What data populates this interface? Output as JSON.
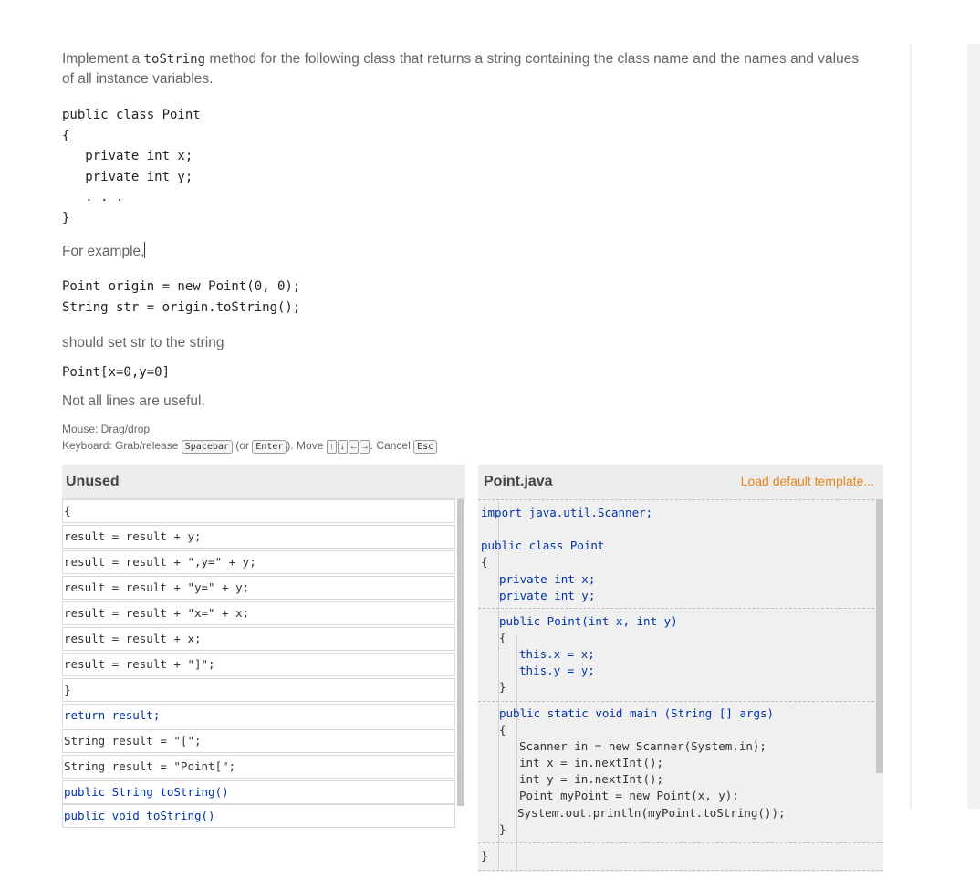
{
  "prompt": {
    "intro_before": "Implement a",
    "intro_code": "toString",
    "intro_after": "method for the following class that returns a string containing the class name and the names and values",
    "intro_line2": "of all instance variables.",
    "class_code": "public class Point\n{\n   private int x;\n   private int y;\n   . . .\n}",
    "for_example": "For example,",
    "example_code": "Point origin = new Point(0, 0);\nString str = origin.toString();",
    "should_set": "should set str to the string",
    "result_code": "Point[x=0,y=0]",
    "not_all": "Not all lines are useful."
  },
  "hints": {
    "mouse": "Mouse: Drag/drop",
    "keyboard_prefix": "Keyboard: Grab/release",
    "spacebar": "Spacebar",
    "or_open": "(or",
    "enter": "Enter",
    "move": "). Move",
    "arrows": [
      "↑",
      "↓",
      "←",
      "→"
    ],
    "cancel": ". Cancel",
    "esc": "Esc"
  },
  "unused": {
    "title": "Unused",
    "tiles": [
      "{",
      "result = result + y;",
      "result = result + \",y=\" + y;",
      "result = result + \"y=\" + y;",
      "result = result + \"x=\" + x;",
      "result = result + x;",
      "result = result + \"]\";",
      "}",
      "return result;",
      "String result = \"[\";",
      "String result = \"Point[\";",
      "public String toString()",
      "public void toString()"
    ]
  },
  "pointjava": {
    "title": "Point.java",
    "load_template": "Load default template...",
    "lines": [
      "import java.util.Scanner;",
      "public class Point",
      "{",
      "private int x;",
      "private int y;",
      "public Point(int x, int y)",
      "{",
      "this.x = x;",
      "this.y = y;",
      "}",
      "public static void main (String [] args)",
      "{",
      "Scanner in = new Scanner(System.in);",
      "int x = in.nextInt();",
      "int y = in.nextInt();",
      "Point myPoint = new Point(x, y);",
      "System.out.println(myPoint.toString());",
      "}",
      "}"
    ]
  }
}
